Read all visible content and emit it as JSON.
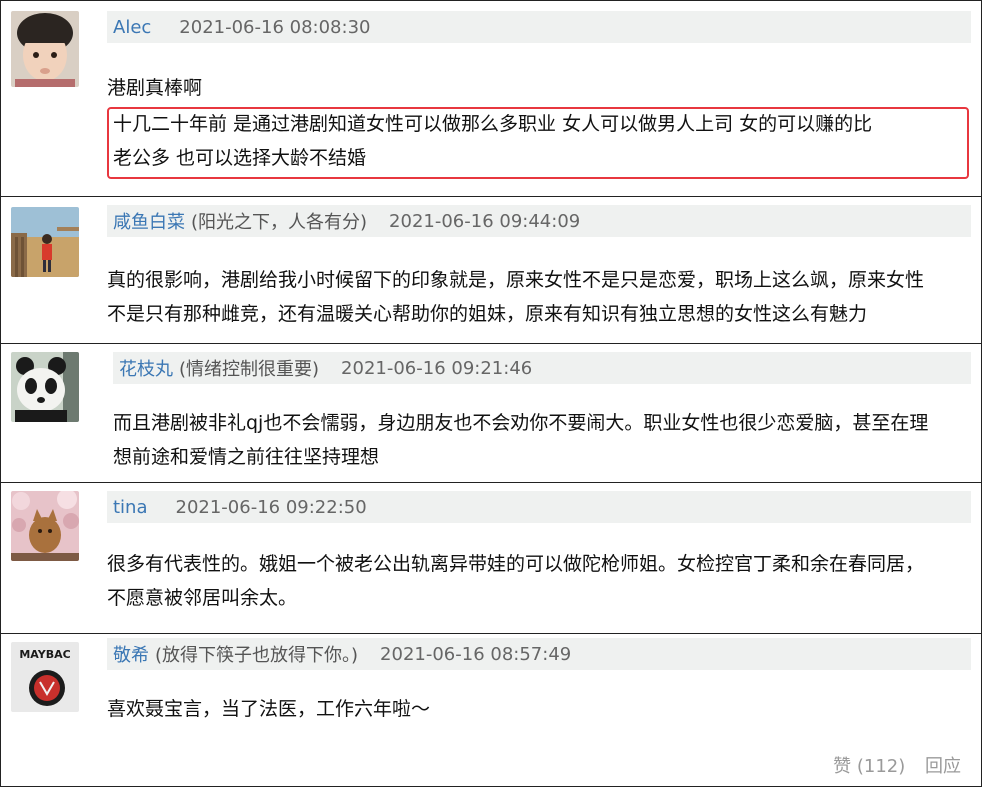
{
  "comments": [
    {
      "author": "Alec",
      "signature": "",
      "time": "2021-06-16 08:08:30",
      "lines": [
        "港剧真棒啊"
      ],
      "highlighted_lines": [
        "十几二十年前 是通过港剧知道女性可以做那么多职业 女人可以做男人上司 女的可以赚的比",
        "老公多 也可以选择大龄不结婚"
      ]
    },
    {
      "author": "咸鱼白菜",
      "signature": "(阳光之下，人各有分)",
      "time": "2021-06-16 09:44:09",
      "lines": [
        "真的很影响，港剧给我小时候留下的印象就是，原来女性不是只是恋爱，职场上这么飒，原来女性",
        "不是只有那种雌竞，还有温暖关心帮助你的姐妹，原来有知识有独立思想的女性这么有魅力"
      ]
    },
    {
      "author": "花枝丸",
      "signature": "(情绪控制很重要)",
      "time": "2021-06-16 09:21:46",
      "lines": [
        "而且港剧被非礼qj也不会懦弱，身边朋友也不会劝你不要闹大。职业女性也很少恋爱脑，甚至在理",
        "想前途和爱情之前往往坚持理想"
      ]
    },
    {
      "author": "tina",
      "signature": "",
      "time": "2021-06-16 09:22:50",
      "lines": [
        "很多有代表性的。娥姐一个被老公出轨离异带娃的可以做陀枪师姐。女检控官丁柔和余在春同居，",
        "不愿意被邻居叫余太。"
      ]
    },
    {
      "author": "敬希",
      "signature": "(放得下筷子也放得下你。)",
      "time": "2021-06-16 08:57:49",
      "lines": [
        "喜欢聂宝言，当了法医，工作六年啦～"
      ],
      "avatar_text": "MAYBAC"
    }
  ],
  "actions": {
    "like_label": "赞 (112)",
    "reply_label": "回应"
  },
  "colors": {
    "author_link": "#3b77b4",
    "meta_bg": "#eff1f0",
    "highlight_border": "#e8373f",
    "divider": "#222222"
  }
}
